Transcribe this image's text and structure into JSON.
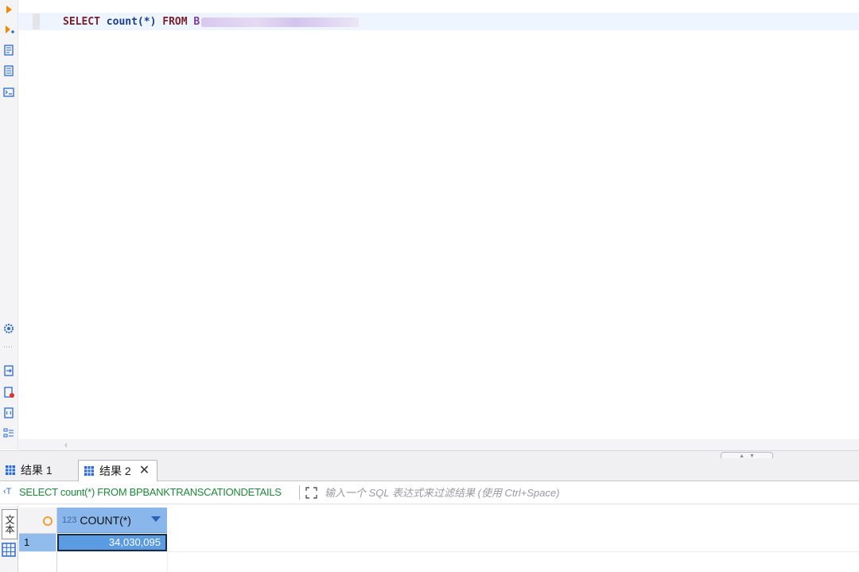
{
  "editor": {
    "sql_keyword_select": "SELECT",
    "sql_function": "count(*)",
    "sql_keyword_from": "FROM",
    "sql_table_prefix": "B"
  },
  "results": {
    "tabs": [
      {
        "label": "结果 1"
      },
      {
        "label": "结果 2"
      }
    ],
    "filter": {
      "query_text": "SELECT count(*) FROM BPBANKTRANSCATIONDETAILS",
      "placeholder": "输入一个 SQL 表达式来过滤结果 (使用 Ctrl+Space)"
    },
    "side_label": "文本",
    "grid": {
      "columns": [
        {
          "type_badge": "123",
          "name": "COUNT(*)"
        }
      ],
      "rows": [
        {
          "row_number": "1",
          "value": "34,030,095"
        }
      ]
    }
  },
  "icons": {
    "toolbar": [
      "run-statement-icon",
      "run-script-icon",
      "explain-plan-icon",
      "load-plan-icon",
      "console-icon",
      "settings-icon",
      "export-icon",
      "error-log-icon",
      "variables-icon",
      "outline-icon"
    ]
  },
  "colors": {
    "keyword": "#7a1f2a",
    "function": "#1a3c8c",
    "table": "#7a3c9c",
    "filter_sql": "#1c8a3a",
    "selected_cell": "#5b9be2",
    "header": "#89b7ec"
  }
}
